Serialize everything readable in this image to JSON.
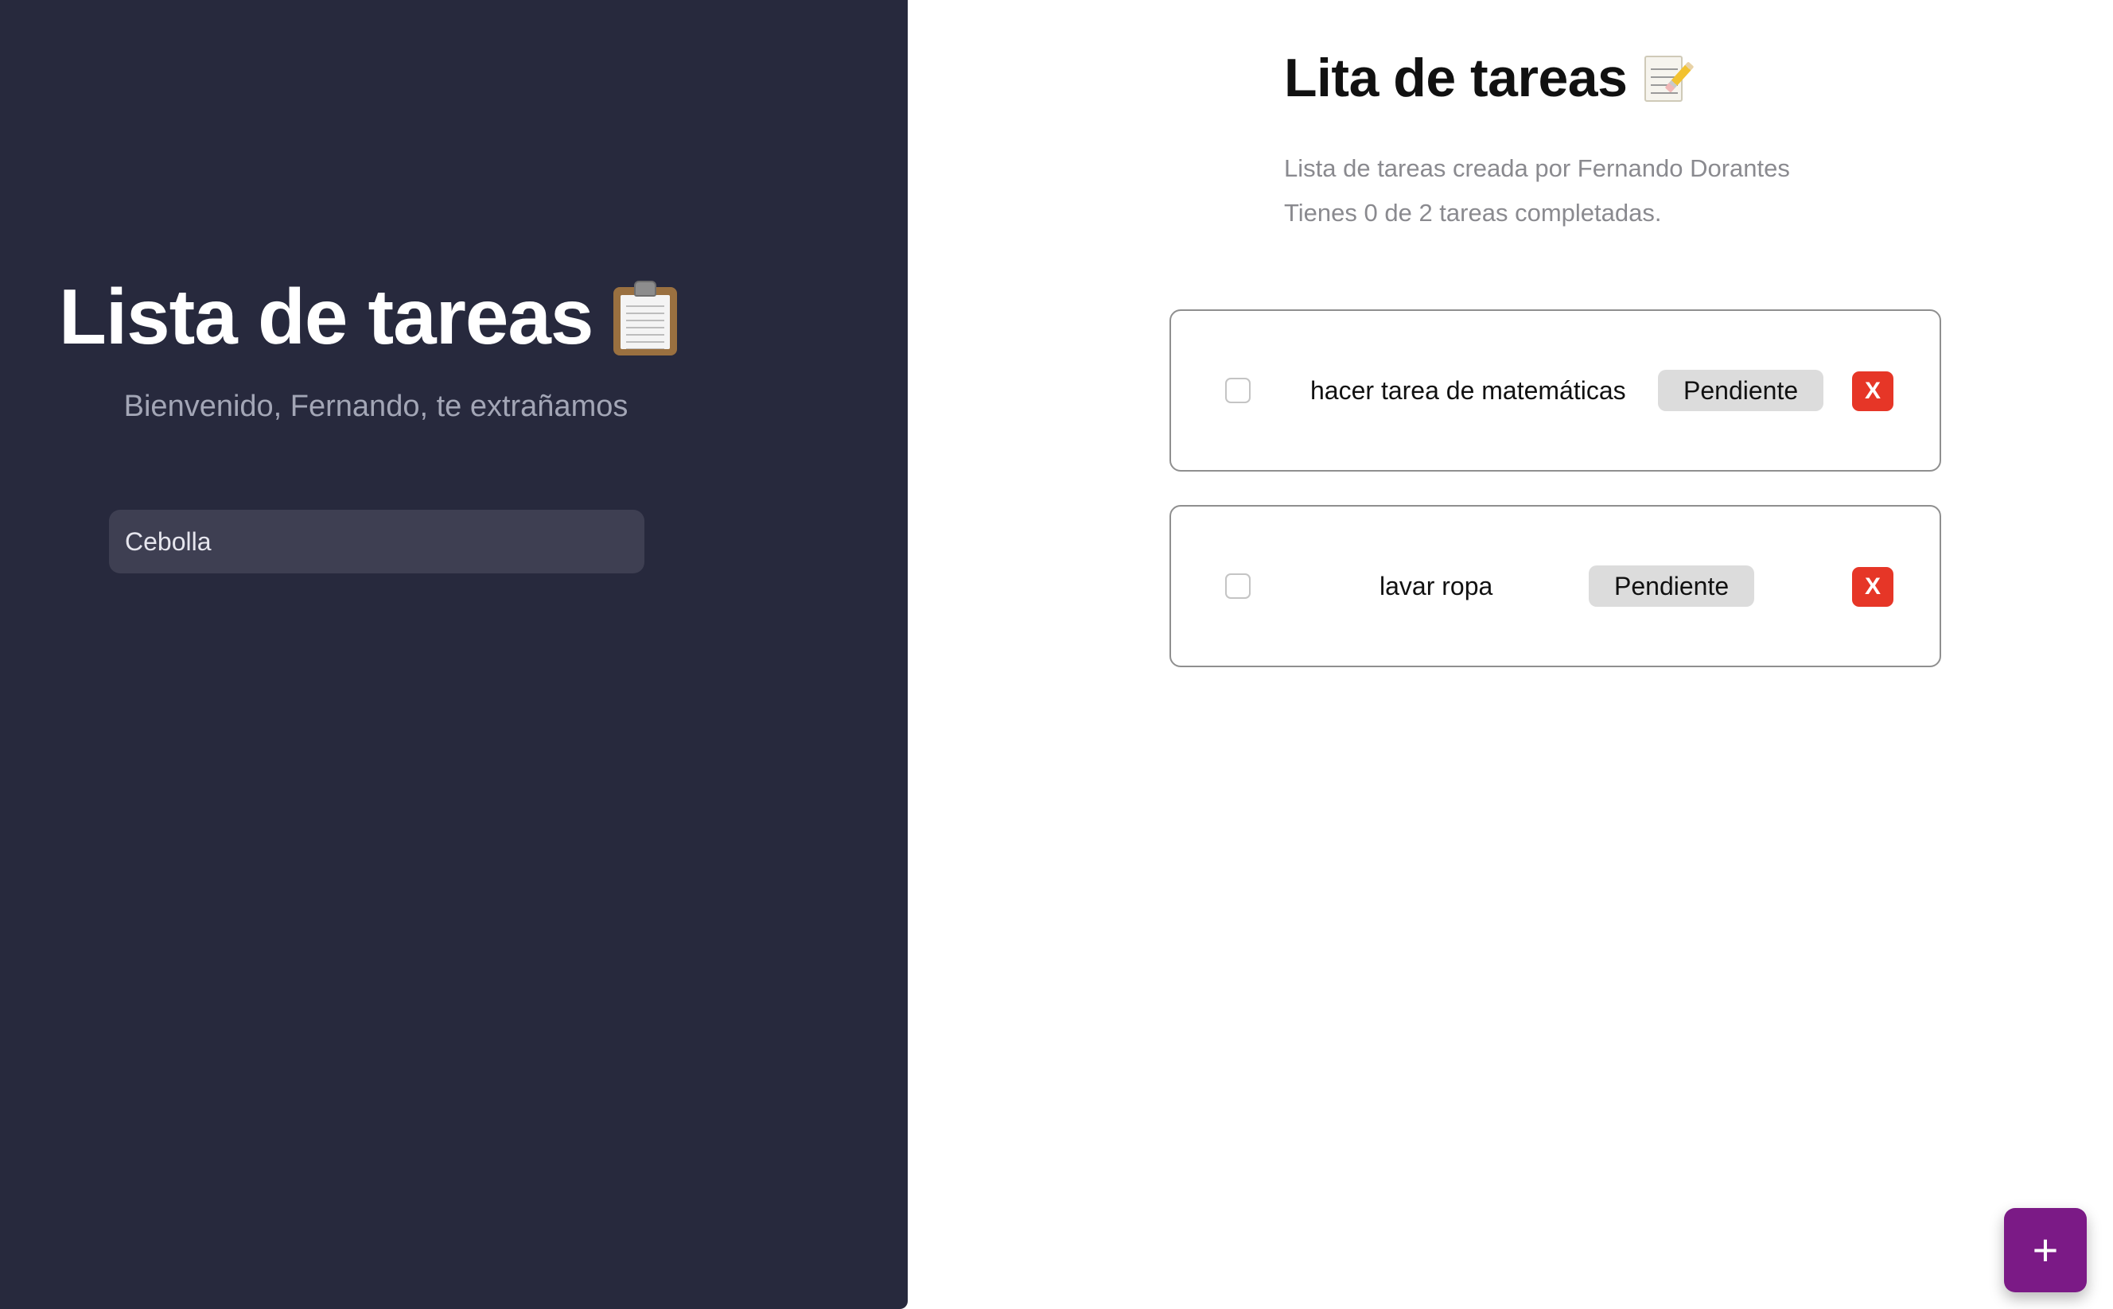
{
  "sidebar": {
    "title": "Lista de tareas",
    "title_icon": "clipboard-icon",
    "welcome": "Bienvenido, Fernando, te extrañamos",
    "name_input": {
      "value": "Cebolla"
    },
    "background_color": "#27293d"
  },
  "main": {
    "title": "Lita de tareas",
    "title_icon": "memo-icon",
    "subtitle": "Lista de tareas creada por Fernando Dorantes",
    "summary": "Tienes 0 de 2 tareas completadas.",
    "tasks": [
      {
        "name": "hacer tarea de matemáticas",
        "status": "Pendiente",
        "completed": false,
        "delete_label": "X"
      },
      {
        "name": "lavar ropa",
        "status": "Pendiente",
        "completed": false,
        "delete_label": "X"
      }
    ]
  },
  "fab": {
    "label": "+",
    "icon": "plus-icon",
    "color": "#7b1a86"
  },
  "colors": {
    "delete": "#e63627",
    "badge": "#dcdcdc",
    "accent": "#7b1a86"
  }
}
